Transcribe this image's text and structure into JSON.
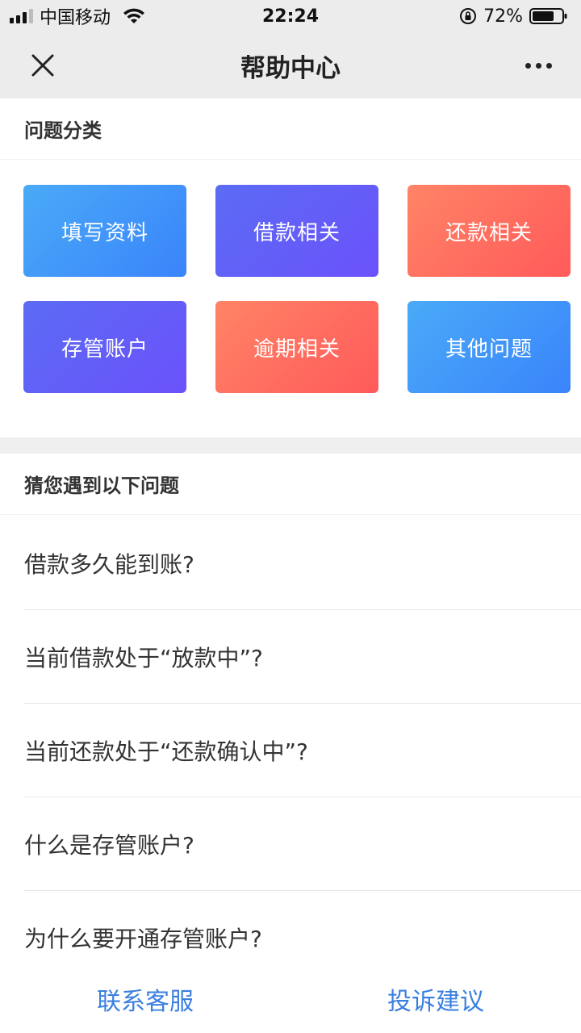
{
  "status_bar": {
    "carrier": "中国移动",
    "time": "22:24",
    "battery": "72%"
  },
  "nav": {
    "title": "帮助中心"
  },
  "categories": {
    "heading": "问题分类",
    "items": [
      {
        "label": "填写资料",
        "color": "blue"
      },
      {
        "label": "借款相关",
        "color": "purple"
      },
      {
        "label": "还款相关",
        "color": "orange"
      },
      {
        "label": "存管账户",
        "color": "purple"
      },
      {
        "label": "逾期相关",
        "color": "orange"
      },
      {
        "label": "其他问题",
        "color": "blue"
      }
    ]
  },
  "faq": {
    "heading": "猜您遇到以下问题",
    "items": [
      "借款多久能到账?",
      "当前借款处于“放款中”?",
      "当前还款处于“还款确认中”?",
      "什么是存管账户?",
      "为什么要开通存管账户?"
    ]
  },
  "footer": {
    "contact_label": "联系客服",
    "complaint_label": "投诉建议"
  },
  "colors": {
    "accent_blue": "#3a7fe0",
    "tile_blue": "#3a84fb",
    "tile_purple": "#6b52fb",
    "tile_orange": "#ff5a5a"
  }
}
